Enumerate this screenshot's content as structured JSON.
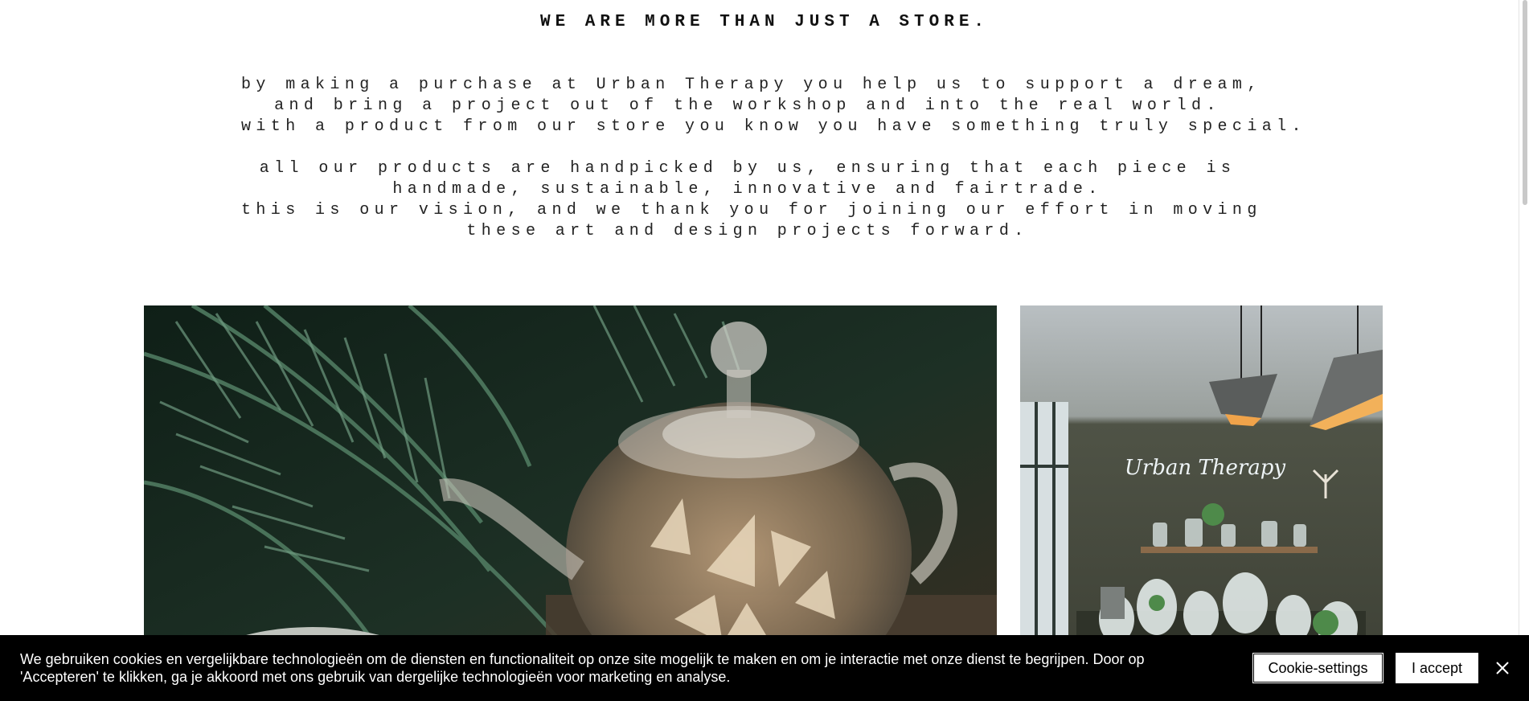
{
  "section": {
    "heading": "WE ARE MORE THAN JUST A STORE.",
    "paragraph_1": [
      "by making a purchase at Urban Therapy you help us to support a dream,",
      "and bring a project out of the workshop and into the real world.",
      "with a product from our store you know you have something truly special."
    ],
    "paragraph_2": [
      "all our products are handpicked by us, ensuring that each piece is",
      "handmade, sustainable, innovative and fairtrade.",
      "this is our vision, and we thank you for joining our effort in moving",
      "these art and design projects forward."
    ]
  },
  "images": {
    "left": "glass teapot with flower tea among palm leaves",
    "right": "Urban Therapy store interior with neon sign"
  },
  "store_sign": "Urban Therapy",
  "cookie_banner": {
    "text": "We gebruiken cookies en vergelijkbare technologieën om de diensten en functionaliteit op onze site mogelijk te maken en om je interactie met onze dienst te begrijpen. Door op 'Accepteren' te klikken, ga je akkoord met ons gebruik van dergelijke technologieën voor marketing en analyse.",
    "settings_label": "Cookie-settings",
    "accept_label": "I accept",
    "close_icon": "close-icon"
  },
  "colors": {
    "banner_bg": "#000000",
    "text": "#111111"
  }
}
